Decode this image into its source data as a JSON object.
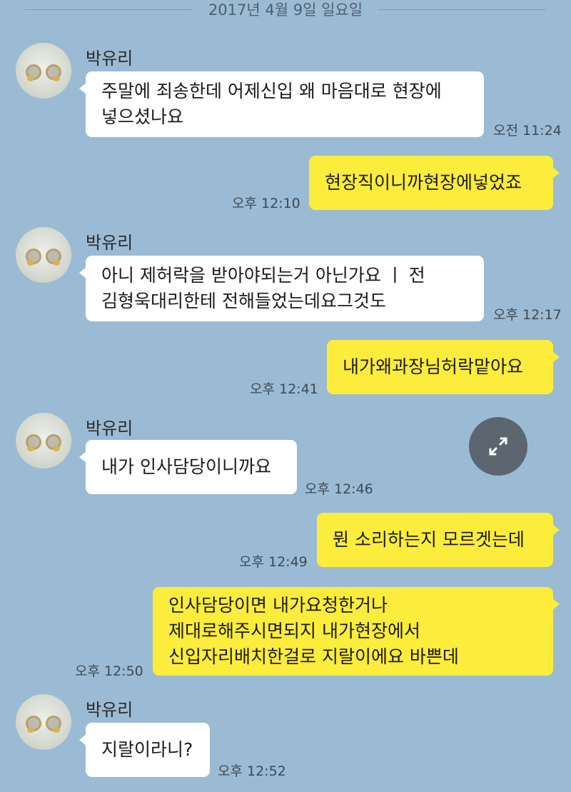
{
  "date_separator": "2017년 4월 9일 일요일",
  "expand_icon": "expand-arrows-icon",
  "colors": {
    "background": "#9bbbd4",
    "incoming_bubble": "#ffffff",
    "outgoing_bubble": "#fcec3c"
  },
  "messages": [
    {
      "sender": "박유리",
      "direction": "in",
      "lines": [
        "주말에 죄송한데 어제신입 왜 마음대로 현장에",
        "넣으셨나요"
      ],
      "time": "오전 11:24"
    },
    {
      "direction": "out",
      "lines": [
        "현장직이니까현장에넣었죠"
      ],
      "time": "오후 12:10"
    },
    {
      "sender": "박유리",
      "direction": "in",
      "lines": [
        "아니 제허락을 받아야되는거 아닌가요 ㅣ 전",
        "김형욱대리한테 전해들었는데요그것도"
      ],
      "time": "오후 12:17"
    },
    {
      "direction": "out",
      "lines": [
        "내가왜과장님허락맡아요"
      ],
      "time": "오후 12:41"
    },
    {
      "sender": "박유리",
      "direction": "in",
      "lines": [
        "내가 인사담당이니까요"
      ],
      "time": "오후 12:46"
    },
    {
      "direction": "out",
      "lines": [
        "뭔 소리하는지 모르겟는데"
      ],
      "time": "오후 12:49"
    },
    {
      "direction": "out",
      "lines": [
        "인사담당이면 내가요청한거나",
        "제대로해주시면되지 내가현장에서",
        "신입자리배치한걸로 지랄이에요 바쁜데"
      ],
      "time": "오후 12:50"
    },
    {
      "sender": "박유리",
      "direction": "in",
      "lines": [
        "지랄이라니?"
      ],
      "time": "오후 12:52"
    }
  ]
}
